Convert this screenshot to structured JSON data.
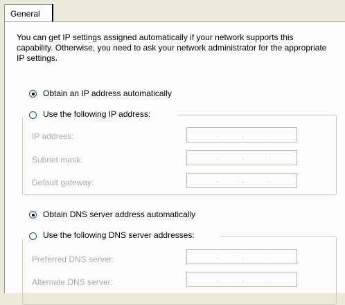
{
  "tabs": [
    {
      "label": "General"
    }
  ],
  "description": "You can get IP settings assigned automatically if your network supports this capability. Otherwise, you need to ask your network administrator for the appropriate IP settings.",
  "ip_mode": {
    "auto_label": "Obtain an IP address automatically",
    "manual_label": "Use the following IP address:",
    "selected": "auto"
  },
  "ip_fields": [
    {
      "label": "IP address:",
      "value": ""
    },
    {
      "label": "Subnet mask:",
      "value": ""
    },
    {
      "label": "Default gateway:",
      "value": ""
    }
  ],
  "dns_mode": {
    "auto_label": "Obtain DNS server address automatically",
    "manual_label": "Use the following DNS server addresses:",
    "selected": "auto"
  },
  "dns_fields": [
    {
      "label": "Preferred DNS server:",
      "value": ""
    },
    {
      "label": "Alternate DNS server:",
      "value": ""
    }
  ],
  "colors": {
    "dialog_bg": "#ece9d8",
    "page_bg": "#fcfcfe",
    "disabled_text": "#acaca1"
  }
}
